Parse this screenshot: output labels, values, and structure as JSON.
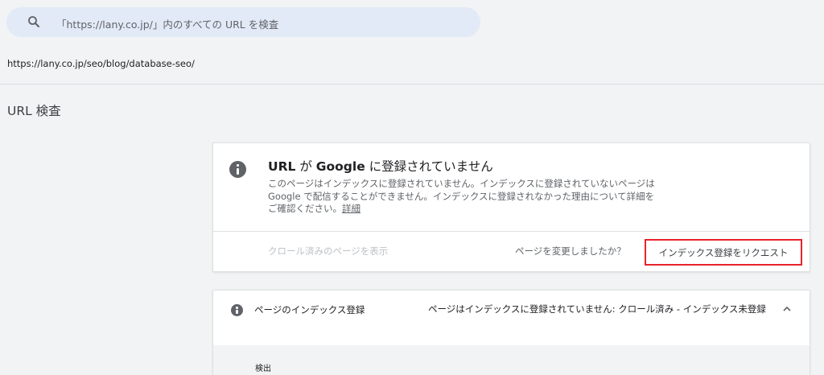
{
  "search": {
    "placeholder": "「https://lany.co.jp/」内のすべての URL を検査"
  },
  "inspected_url": "https://lany.co.jp/seo/blog/database-seo/",
  "page_title": "URL 検査",
  "status_card": {
    "heading_part1": "URL",
    "heading_part2": " が ",
    "heading_part3": "Google",
    "heading_part4": " に登録されていません",
    "description": "このページはインデックスに登録されていません。インデックスに登録されていないページは Google で配信することができません。インデックスに登録されなかった理由について詳細をご確認ください。",
    "learn_more": "詳細",
    "view_crawled_label": "クロール済みのページを表示",
    "changed_question": "ページを変更しましたか？",
    "request_indexing_label": "インデックス登録をリクエスト",
    "highlight_color": "#e8232b"
  },
  "coverage_card": {
    "label": "ページのインデックス登録",
    "value": "ページはインデックスに登録されていません: クロール済み - インデックス未登録",
    "section_label": "検出"
  }
}
